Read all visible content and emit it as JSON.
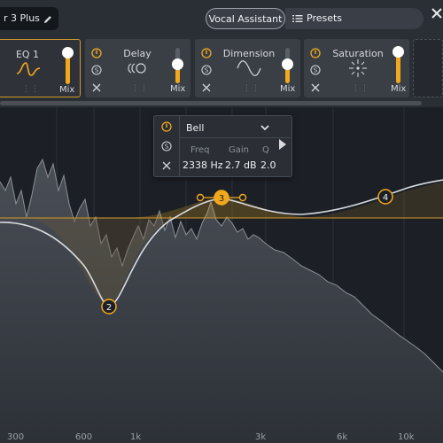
{
  "header": {
    "preset_name": "r 3 Plus",
    "vocal_assistant_label": "Vocal Assistant",
    "presets_label": "Presets"
  },
  "modules": [
    {
      "name": "EQ 1",
      "mix": "Mix",
      "selected": true,
      "mix_level": 0.85
    },
    {
      "name": "Delay",
      "mix": "Mix",
      "selected": false,
      "mix_level": 0.45
    },
    {
      "name": "Dimension",
      "mix": "Mix",
      "selected": false,
      "mix_level": 0.45
    },
    {
      "name": "Saturation",
      "mix": "Mix",
      "selected": false,
      "mix_level": 0.85
    }
  ],
  "band_popup": {
    "type": "Bell",
    "freq_label": "Freq",
    "gain_label": "Gain",
    "q_label": "Q",
    "freq_value": "2338 Hz",
    "gain_value": "2.7 dB",
    "q_value": "2.0"
  },
  "eq_nodes": [
    {
      "id": "2",
      "active": false
    },
    {
      "id": "3",
      "active": true
    },
    {
      "id": "4",
      "active": false
    }
  ],
  "freq_axis": [
    "300",
    "600",
    "1k",
    "3k",
    "6k",
    "10k"
  ],
  "colors": {
    "accent": "#f2a81d",
    "background": "#1c2026",
    "panel": "#2a2e35"
  }
}
